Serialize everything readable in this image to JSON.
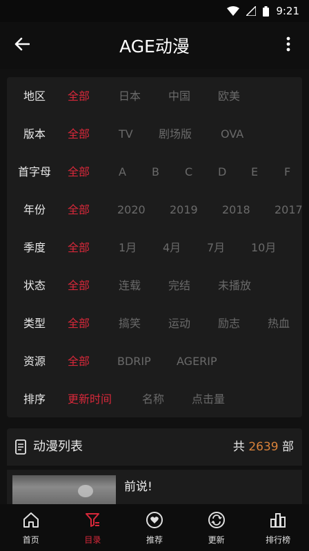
{
  "status": {
    "time": "9:21"
  },
  "app_bar": {
    "title": "AGE动漫"
  },
  "filters": [
    {
      "label": "地区",
      "options": [
        "全部",
        "日本",
        "中国",
        "欧美"
      ],
      "active": 0
    },
    {
      "label": "版本",
      "options": [
        "全部",
        "TV",
        "剧场版",
        "OVA"
      ],
      "active": 0
    },
    {
      "label": "首字母",
      "options": [
        "全部",
        "A",
        "B",
        "C",
        "D",
        "E",
        "F"
      ],
      "active": 0
    },
    {
      "label": "年份",
      "options": [
        "全部",
        "2020",
        "2019",
        "2018",
        "2017"
      ],
      "active": 0
    },
    {
      "label": "季度",
      "options": [
        "全部",
        "1月",
        "4月",
        "7月",
        "10月"
      ],
      "active": 0
    },
    {
      "label": "状态",
      "options": [
        "全部",
        "连载",
        "完结",
        "未播放"
      ],
      "active": 0
    },
    {
      "label": "类型",
      "options": [
        "全部",
        "搞笑",
        "运动",
        "励志",
        "热血"
      ],
      "active": 0
    },
    {
      "label": "资源",
      "options": [
        "全部",
        "BDRIP",
        "AGERIP"
      ],
      "active": 0
    },
    {
      "label": "排序",
      "options": [
        "更新时间",
        "名称",
        "点击量"
      ],
      "active": 0
    }
  ],
  "list": {
    "title": "动漫列表",
    "count_prefix": "共",
    "count": "2639",
    "count_suffix": "部"
  },
  "anime_items": [
    {
      "title": "前说!"
    }
  ],
  "bottom_nav": [
    {
      "label": "首页",
      "icon": "home-icon"
    },
    {
      "label": "目录",
      "icon": "catalog-icon"
    },
    {
      "label": "推荐",
      "icon": "heart-icon"
    },
    {
      "label": "更新",
      "icon": "update-icon"
    },
    {
      "label": "排行榜",
      "icon": "chart-icon"
    }
  ],
  "colors": {
    "accent": "#d8283a",
    "count": "#d9823a",
    "background": "#111111",
    "card": "#1c1c1c"
  }
}
